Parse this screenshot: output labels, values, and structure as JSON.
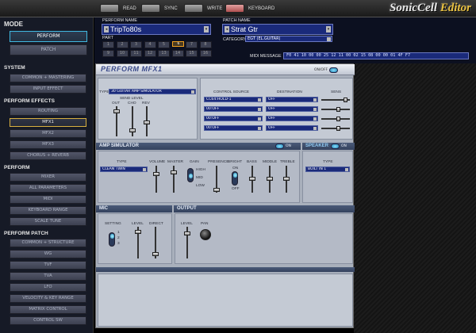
{
  "toolbar": {
    "read": "READ",
    "sync": "SYNC",
    "write": "WRITE",
    "keyboard": "KEYBOARD",
    "logo_main": "SonicCell",
    "logo_editor": " Editor"
  },
  "sidebar": {
    "mode_heading": "MODE",
    "mode_items": [
      "PERFORM",
      "PATCH"
    ],
    "system_heading": "SYSTEM",
    "system_items": [
      "COMMON + MASTERING",
      "INPUT EFFECT"
    ],
    "effects_heading": "PERFORM EFFECTS",
    "effects_items": [
      "ROUTING",
      "MFX1",
      "MFX2",
      "MFX3",
      "CHORUS + REVERB"
    ],
    "perform_heading": "PERFORM",
    "perform_items": [
      "MIXER",
      "ALL PARAMETERS",
      "MIDI",
      "KEYBOARD RANGE",
      "SCALE TUNE"
    ],
    "patch_heading": "PERFORM PATCH",
    "patch_items": [
      "COMMON + STRUCTURE",
      "WG",
      "TVF",
      "TVA",
      "LFO",
      "VELOCITY & KEY RANGE",
      "MATRIX CONTROL",
      "CONTROL SW"
    ]
  },
  "header": {
    "perform_name_label": "PERFORM NAME",
    "perform_name": "TripTo80s",
    "part_label": "PART",
    "parts": [
      "1",
      "2",
      "3",
      "4",
      "5",
      "6",
      "7",
      "8",
      "9",
      "10",
      "11",
      "12",
      "13",
      "14",
      "15",
      "16"
    ],
    "selected_part": "6",
    "patch_name_label": "PATCH NAME",
    "patch_name": "Strat Gtr",
    "category_label": "CATEGORY",
    "category": "EGT (EL.GUITAR)",
    "midi_label": "MIDI MESSAGE",
    "midi_message": "F0 41 10 00 00 25 12 11 00 02 15 08 00 00 01 4F F7"
  },
  "panel": {
    "title": "PERFORM MFX1",
    "onoff_label": "ON/OFF",
    "type_label": "TYPE",
    "type_value": "30 GUITAR AMP SIMULATOR",
    "send_level_label": "SEND LEVEL",
    "out_label": "OUT",
    "cho_label": "CHO",
    "rev_label": "REV",
    "control_source_label": "CONTROL SOURCE",
    "destination_label": "DESTINATION",
    "sens_label": "SENS",
    "controls": [
      {
        "source": "CC64:HOLD-1",
        "dest": "OFF"
      },
      {
        "source": "00:OFF",
        "dest": "OFF"
      },
      {
        "source": "00:OFF",
        "dest": "OFF"
      },
      {
        "source": "00:OFF",
        "dest": "OFF"
      }
    ],
    "amp_heading": "AMP SIMULATOR",
    "amp_on": "ON",
    "amp_type_label": "TYPE",
    "amp_type": "CLEAN TWIN",
    "volume_label": "VOLUME",
    "master_label": "MASTER",
    "gain_label": "GAIN",
    "gain_high": "HIGH",
    "gain_mid": "MID",
    "gain_low": "LOW",
    "presence_label": "PRESENCE",
    "bright_label": "BRIGHT",
    "bright_on": "ON",
    "bright_off": "OFF",
    "bass_label": "BASS",
    "middle_label": "MIDDLE",
    "treble_label": "TREBLE",
    "speaker_heading": "SPEAKER",
    "speaker_on": "ON",
    "speaker_type_label": "TYPE",
    "speaker_type": "BUILT IN 1",
    "mic_heading": "MIC",
    "mic_setting_label": "SETTING",
    "mic_level_label": "LEVEL",
    "mic_direct_label": "DIRECT",
    "mic_setting_values": [
      "1",
      "2",
      "3"
    ],
    "output_heading": "OUTPUT",
    "output_level_label": "LEVEL",
    "output_pan_label": "PAN"
  }
}
